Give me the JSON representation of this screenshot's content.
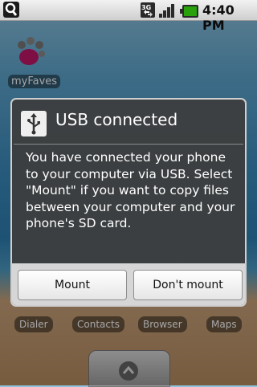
{
  "status_bar": {
    "time": "4:40 PM",
    "network": "3G",
    "icons": [
      "search-icon",
      "3g-icon",
      "signal-icon",
      "battery-icon"
    ]
  },
  "home": {
    "app_label": "myFaves",
    "dock": [
      "Dialer",
      "Contacts",
      "Browser",
      "Maps"
    ]
  },
  "dialog": {
    "title": "USB connected",
    "icon": "usb-icon",
    "message": "You have connected your phone to your computer via USB. Select \"Mount\" if you want to copy files between your computer and your phone's SD card.",
    "buttons": {
      "mount": "Mount",
      "dont_mount": "Don't mount"
    }
  },
  "colors": {
    "battery": "#29a10b",
    "dialog_bg": "#3e3e3e"
  }
}
